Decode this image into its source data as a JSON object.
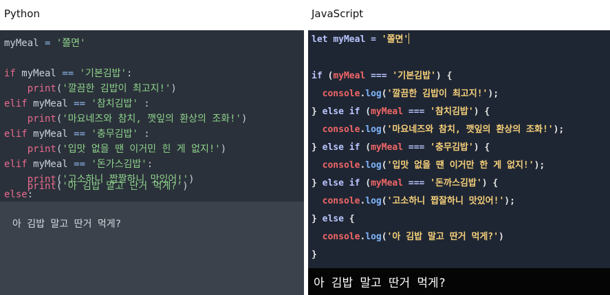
{
  "python": {
    "title": "Python",
    "lines": [
      {
        "a": "myMeal",
        "b": " = ",
        "c": "'쫄면'"
      },
      {
        "a": "",
        "b": "",
        "c": ""
      },
      {
        "kw": "if",
        "id": " myMeal ",
        "op": "==",
        "str": " '기본김밥'",
        "tail": ":"
      },
      {
        "indent": "    ",
        "fn": "print",
        "p1": "(",
        "str": "'깔끔한 김밥이 최고지!'",
        "p2": ")"
      },
      {
        "kw": "elif",
        "id": " myMeal ",
        "op": "==",
        "str": " '참치김밥'",
        "tail": " :"
      },
      {
        "indent": "    ",
        "fn": "print",
        "p1": "(",
        "str": "'마요네즈와 참치, 깻잎의 환상의 조화!'",
        "p2": ")"
      },
      {
        "kw": "elif",
        "id": " myMeal ",
        "op": "==",
        "str": " '충무김밥'",
        "tail": " :"
      },
      {
        "indent": "    ",
        "fn": "print",
        "p1": "(",
        "str": "'입맛 없을 땐 이거민 힌 게 없지!'",
        "p2": ")"
      },
      {
        "kw": "elif",
        "id": " myMeal ",
        "op": "==",
        "str": " '돈가스김밥'",
        "tail": ":"
      },
      {
        "indent": "    ",
        "fn": "print",
        "p1": "(",
        "str": "'고소하니 짭짤하니 맛있어!'",
        "p2": ")"
      },
      {
        "kw": "else",
        "tail": ":"
      },
      {
        "indent": "    ",
        "fn": "print",
        "p1": "(",
        "str": "'아 김밥 말고 단거 먹게?'",
        "p2": ")"
      }
    ],
    "output": "아 김밥 말고 딴거 먹게?"
  },
  "javascript": {
    "title": "JavaScript",
    "lines": [
      {
        "kw": "let",
        "sp": " ",
        "var": "myMeal",
        "op": " = ",
        "str": "'쫄면'"
      },
      {},
      {
        "kw": "if",
        "p1": " (",
        "var": "myMeal",
        "op": " === ",
        "str": "'기본김밥'",
        "p2": ") {"
      },
      {
        "ind": "  ",
        "obj": "console",
        "dot": ".",
        "fn": "log",
        "p1": "(",
        "str": "'깔끔한 김밥이 최고지!'",
        "p2": ");"
      },
      {
        "p0": "} ",
        "kw": "else if",
        "p1": " (",
        "var": "myMeal",
        "op": " === ",
        "str": "'참치김밥'",
        "p2": ") {"
      },
      {
        "ind": "  ",
        "obj": "console",
        "dot": ".",
        "fn": "log",
        "p1": "(",
        "str": "'마요네즈와 참치, 깻잎의 환상의 조화!'",
        "p2": ");"
      },
      {
        "p0": "} ",
        "kw": "else if",
        "p1": " (",
        "var": "myMeal",
        "op": " === ",
        "str": "'충무김밥'",
        "p2": ") {"
      },
      {
        "ind": "  ",
        "obj": "console",
        "dot": ".",
        "fn": "log",
        "p1": "(",
        "str": "'입맛 없을 땐 이거만 한 게 없지!'",
        "p2": ");"
      },
      {
        "p0": "} ",
        "kw": "else if",
        "p1": " (",
        "var": "myMeal",
        "op": " === ",
        "str": "'돈까스김밥'",
        "p2": ") {"
      },
      {
        "ind": "  ",
        "obj": "console",
        "dot": ".",
        "fn": "log",
        "p1": "(",
        "str": "'고소하니 짭잘하니 맛있어!'",
        "p2": ");"
      },
      {
        "p0": "} ",
        "kw": "else",
        "p2": " {"
      },
      {
        "ind": "  ",
        "obj": "console",
        "dot": ".",
        "fn": "log",
        "p1": "(",
        "str": "'아 김밥 말고 딴거 먹게?'",
        "p2": ")"
      },
      {
        "p0": "}"
      }
    ],
    "output": "아 김밥 말고 딴거 먹게?"
  }
}
